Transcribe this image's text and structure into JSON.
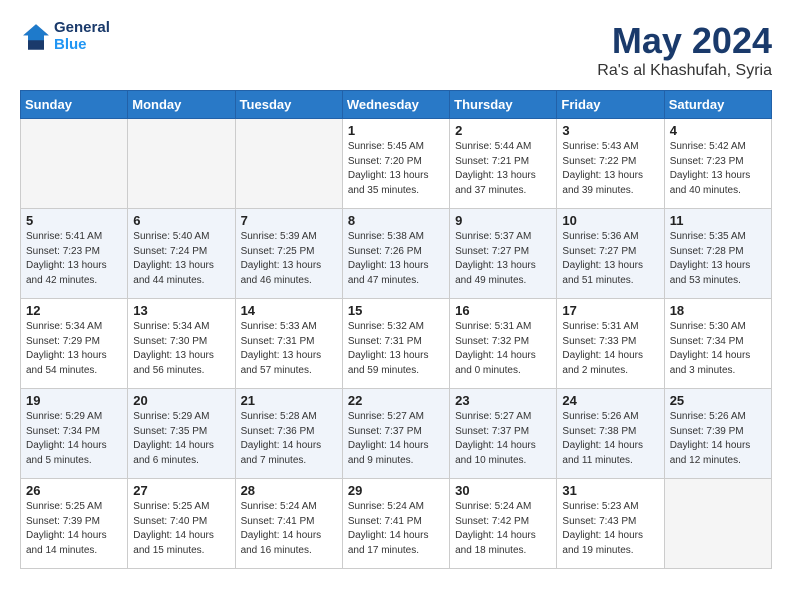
{
  "header": {
    "logo_line1": "General",
    "logo_line2": "Blue",
    "month": "May 2024",
    "location": "Ra's al Khashufah, Syria"
  },
  "weekdays": [
    "Sunday",
    "Monday",
    "Tuesday",
    "Wednesday",
    "Thursday",
    "Friday",
    "Saturday"
  ],
  "weeks": [
    [
      {
        "day": "",
        "info": ""
      },
      {
        "day": "",
        "info": ""
      },
      {
        "day": "",
        "info": ""
      },
      {
        "day": "1",
        "info": "Sunrise: 5:45 AM\nSunset: 7:20 PM\nDaylight: 13 hours\nand 35 minutes."
      },
      {
        "day": "2",
        "info": "Sunrise: 5:44 AM\nSunset: 7:21 PM\nDaylight: 13 hours\nand 37 minutes."
      },
      {
        "day": "3",
        "info": "Sunrise: 5:43 AM\nSunset: 7:22 PM\nDaylight: 13 hours\nand 39 minutes."
      },
      {
        "day": "4",
        "info": "Sunrise: 5:42 AM\nSunset: 7:23 PM\nDaylight: 13 hours\nand 40 minutes."
      }
    ],
    [
      {
        "day": "5",
        "info": "Sunrise: 5:41 AM\nSunset: 7:23 PM\nDaylight: 13 hours\nand 42 minutes."
      },
      {
        "day": "6",
        "info": "Sunrise: 5:40 AM\nSunset: 7:24 PM\nDaylight: 13 hours\nand 44 minutes."
      },
      {
        "day": "7",
        "info": "Sunrise: 5:39 AM\nSunset: 7:25 PM\nDaylight: 13 hours\nand 46 minutes."
      },
      {
        "day": "8",
        "info": "Sunrise: 5:38 AM\nSunset: 7:26 PM\nDaylight: 13 hours\nand 47 minutes."
      },
      {
        "day": "9",
        "info": "Sunrise: 5:37 AM\nSunset: 7:27 PM\nDaylight: 13 hours\nand 49 minutes."
      },
      {
        "day": "10",
        "info": "Sunrise: 5:36 AM\nSunset: 7:27 PM\nDaylight: 13 hours\nand 51 minutes."
      },
      {
        "day": "11",
        "info": "Sunrise: 5:35 AM\nSunset: 7:28 PM\nDaylight: 13 hours\nand 53 minutes."
      }
    ],
    [
      {
        "day": "12",
        "info": "Sunrise: 5:34 AM\nSunset: 7:29 PM\nDaylight: 13 hours\nand 54 minutes."
      },
      {
        "day": "13",
        "info": "Sunrise: 5:34 AM\nSunset: 7:30 PM\nDaylight: 13 hours\nand 56 minutes."
      },
      {
        "day": "14",
        "info": "Sunrise: 5:33 AM\nSunset: 7:31 PM\nDaylight: 13 hours\nand 57 minutes."
      },
      {
        "day": "15",
        "info": "Sunrise: 5:32 AM\nSunset: 7:31 PM\nDaylight: 13 hours\nand 59 minutes."
      },
      {
        "day": "16",
        "info": "Sunrise: 5:31 AM\nSunset: 7:32 PM\nDaylight: 14 hours\nand 0 minutes."
      },
      {
        "day": "17",
        "info": "Sunrise: 5:31 AM\nSunset: 7:33 PM\nDaylight: 14 hours\nand 2 minutes."
      },
      {
        "day": "18",
        "info": "Sunrise: 5:30 AM\nSunset: 7:34 PM\nDaylight: 14 hours\nand 3 minutes."
      }
    ],
    [
      {
        "day": "19",
        "info": "Sunrise: 5:29 AM\nSunset: 7:34 PM\nDaylight: 14 hours\nand 5 minutes."
      },
      {
        "day": "20",
        "info": "Sunrise: 5:29 AM\nSunset: 7:35 PM\nDaylight: 14 hours\nand 6 minutes."
      },
      {
        "day": "21",
        "info": "Sunrise: 5:28 AM\nSunset: 7:36 PM\nDaylight: 14 hours\nand 7 minutes."
      },
      {
        "day": "22",
        "info": "Sunrise: 5:27 AM\nSunset: 7:37 PM\nDaylight: 14 hours\nand 9 minutes."
      },
      {
        "day": "23",
        "info": "Sunrise: 5:27 AM\nSunset: 7:37 PM\nDaylight: 14 hours\nand 10 minutes."
      },
      {
        "day": "24",
        "info": "Sunrise: 5:26 AM\nSunset: 7:38 PM\nDaylight: 14 hours\nand 11 minutes."
      },
      {
        "day": "25",
        "info": "Sunrise: 5:26 AM\nSunset: 7:39 PM\nDaylight: 14 hours\nand 12 minutes."
      }
    ],
    [
      {
        "day": "26",
        "info": "Sunrise: 5:25 AM\nSunset: 7:39 PM\nDaylight: 14 hours\nand 14 minutes."
      },
      {
        "day": "27",
        "info": "Sunrise: 5:25 AM\nSunset: 7:40 PM\nDaylight: 14 hours\nand 15 minutes."
      },
      {
        "day": "28",
        "info": "Sunrise: 5:24 AM\nSunset: 7:41 PM\nDaylight: 14 hours\nand 16 minutes."
      },
      {
        "day": "29",
        "info": "Sunrise: 5:24 AM\nSunset: 7:41 PM\nDaylight: 14 hours\nand 17 minutes."
      },
      {
        "day": "30",
        "info": "Sunrise: 5:24 AM\nSunset: 7:42 PM\nDaylight: 14 hours\nand 18 minutes."
      },
      {
        "day": "31",
        "info": "Sunrise: 5:23 AM\nSunset: 7:43 PM\nDaylight: 14 hours\nand 19 minutes."
      },
      {
        "day": "",
        "info": ""
      }
    ]
  ],
  "alt_rows": [
    1,
    3
  ]
}
